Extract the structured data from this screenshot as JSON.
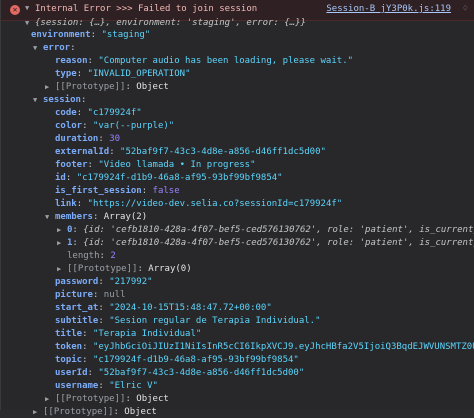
{
  "header": {
    "message": "Internal Error >>> Failed to join session",
    "source": "Session-B_jY3P0k.js:119"
  },
  "summary": "{session: {…}, environment: 'staging', error: {…}}",
  "environment": {
    "key": "environment",
    "value": "\"staging\""
  },
  "error": {
    "key": "error",
    "reason": {
      "key": "reason",
      "value": "\"Computer audio has been loading, please wait.\""
    },
    "type": {
      "key": "type",
      "value": "\"INVALID_OPERATION\""
    },
    "prototype": {
      "key": "[[Prototype]]",
      "value": "Object"
    }
  },
  "session": {
    "key": "session",
    "code": {
      "key": "code",
      "value": "\"c179924f\""
    },
    "color": {
      "key": "color",
      "value": "\"var(--purple)\""
    },
    "duration": {
      "key": "duration",
      "value": "30"
    },
    "externalId": {
      "key": "externalId",
      "value": "\"52baf9f7-43c3-4d8e-a856-d46ff1dc5d00\""
    },
    "footer": {
      "key": "footer",
      "value": "\"Video llamada • In progress\""
    },
    "id": {
      "key": "id",
      "value": "\"c179924f-d1b9-46a8-af95-93bf99bf9854\""
    },
    "is_first_session": {
      "key": "is_first_session",
      "value": "false"
    },
    "link": {
      "key": "link",
      "value": "\"https://video-dev.selia.co?sessionId=c179924f\""
    },
    "members": {
      "key": "members",
      "summary": "Array(2)",
      "items": [
        {
          "index": "0",
          "text": "{id: 'cefb1810-428a-4f07-bef5-ced576130762', role: 'patient', is_current_"
        },
        {
          "index": "1",
          "text": "{id: 'cefb1810-428a-4f07-bef5-ced576130762', role: 'patient', is_current_"
        }
      ],
      "length": {
        "key": "length",
        "value": "2"
      },
      "prototype": {
        "key": "[[Prototype]]",
        "value": "Array(0)"
      }
    },
    "password": {
      "key": "password",
      "value": "\"217992\""
    },
    "picture": {
      "key": "picture",
      "value": "null"
    },
    "start_at": {
      "key": "start_at",
      "value": "\"2024-10-15T15:48:47.72+00:00\""
    },
    "subtitle": {
      "key": "subtitle",
      "value": "\"Sesion regular de Terapia Individual.\""
    },
    "title": {
      "key": "title",
      "value": "\"Terapia Individual\""
    },
    "token": {
      "key": "token",
      "value": "\"eyJhbGciOiJIUzI1NiIsInR5cCI6IkpXVCJ9.eyJhcHBfa2V5IjoiQ3BqdEJWVUNSMTZ0Ul"
    },
    "topic": {
      "key": "topic",
      "value": "\"c179924f-d1b9-46a8-af95-93bf99bf9854\""
    },
    "userId": {
      "key": "userId",
      "value": "\"52baf9f7-43c3-4d8e-a856-d46ff1dc5d00\""
    },
    "username": {
      "key": "username",
      "value": "\"Elric V\""
    },
    "prototype": {
      "key": "[[Prototype]]",
      "value": "Object"
    }
  },
  "root_prototype": {
    "key": "[[Prototype]]",
    "value": "Object"
  }
}
